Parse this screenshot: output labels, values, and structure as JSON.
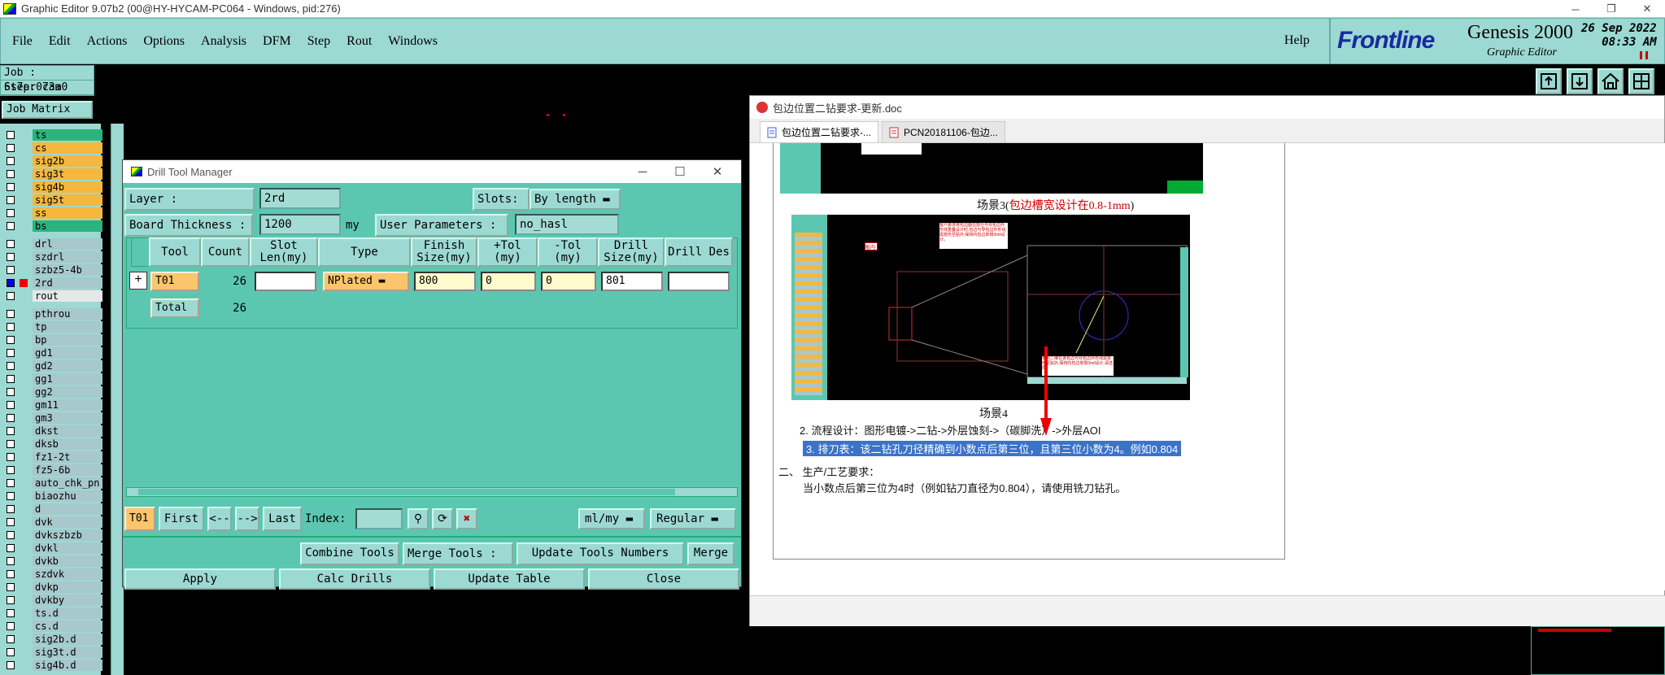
{
  "window": {
    "title": "Graphic Editor 9.07b2 (00@HY-HYCAM-PC064 - Windows, pid:276)",
    "min": "─",
    "restore": "❐",
    "close": "✕"
  },
  "menu": {
    "items": [
      "File",
      "Edit",
      "Actions",
      "Options",
      "Analysis",
      "DFM",
      "Step",
      "Rout",
      "Windows"
    ],
    "help": "Help"
  },
  "logo": {
    "brand": "Frontline",
    "product": "Genesis 2000",
    "subtitle": "Graphic Editor",
    "date": "26 Sep 2022",
    "time": "08:33 AM"
  },
  "job": {
    "job_line": "Job : 6s7er073a0",
    "step_line": "Step: cam",
    "matrix_btn": "Job Matrix ..."
  },
  "layers": {
    "group1": [
      {
        "name": "ts",
        "color": "#2bb37e"
      },
      {
        "name": "cs",
        "color": "#f5b73e"
      },
      {
        "name": "sig2b",
        "color": "#f5b73e"
      },
      {
        "name": "sig3t",
        "color": "#f5b73e"
      },
      {
        "name": "sig4b",
        "color": "#f5b73e"
      },
      {
        "name": "sig5t",
        "color": "#f5b73e"
      },
      {
        "name": "ss",
        "color": "#f5b73e"
      },
      {
        "name": "bs",
        "color": "#2bb37e"
      }
    ],
    "group2": [
      {
        "name": "drl",
        "color": "#a7c8cc"
      },
      {
        "name": "szdrl",
        "color": "#a7c8cc"
      },
      {
        "name": "szbz5-4b",
        "color": "#a7c8cc"
      },
      {
        "name": "2rd",
        "color": "#a7c8cc"
      },
      {
        "name": "rout",
        "color": "#e7e7e7"
      }
    ],
    "group3": [
      {
        "name": "pthrou",
        "color": "#a7c8cc"
      },
      {
        "name": "tp",
        "color": "#a7c8cc"
      },
      {
        "name": "bp",
        "color": "#a7c8cc"
      },
      {
        "name": "gd1",
        "color": "#a7c8cc"
      },
      {
        "name": "gd2",
        "color": "#a7c8cc"
      },
      {
        "name": "gg1",
        "color": "#a7c8cc"
      },
      {
        "name": "gg2",
        "color": "#a7c8cc"
      },
      {
        "name": "gm11",
        "color": "#a7c8cc"
      },
      {
        "name": "gm3",
        "color": "#a7c8cc"
      },
      {
        "name": "dkst",
        "color": "#a7c8cc"
      },
      {
        "name": "dksb",
        "color": "#a7c8cc"
      },
      {
        "name": "fz1-2t",
        "color": "#a7c8cc"
      },
      {
        "name": "fz5-6b",
        "color": "#a7c8cc"
      },
      {
        "name": "auto_chk_pn",
        "color": "#a7c8cc"
      },
      {
        "name": "biaozhu",
        "color": "#a7c8cc"
      },
      {
        "name": "d",
        "color": "#a7c8cc"
      },
      {
        "name": "dvk",
        "color": "#a7c8cc"
      },
      {
        "name": "dvkszbzb",
        "color": "#a7c8cc"
      },
      {
        "name": "dvkl",
        "color": "#a7c8cc"
      },
      {
        "name": "dvkb",
        "color": "#a7c8cc"
      },
      {
        "name": "szdvk",
        "color": "#a7c8cc"
      },
      {
        "name": "dvkp",
        "color": "#a7c8cc"
      },
      {
        "name": "dvkby",
        "color": "#a7c8cc"
      },
      {
        "name": "ts.d",
        "color": "#a7c8cc"
      },
      {
        "name": "cs.d",
        "color": "#a7c8cc"
      },
      {
        "name": "sig2b.d",
        "color": "#a7c8cc"
      },
      {
        "name": "sig3t.d",
        "color": "#a7c8cc"
      },
      {
        "name": "sig4b.d",
        "color": "#a7c8cc"
      }
    ]
  },
  "dtm": {
    "title": "Drill Tool Manager",
    "layer_label": "Layer            :",
    "layer_value": "2rd",
    "slots_label": "Slots:",
    "slots_value": "By length",
    "thickness_label": "Board Thickness :",
    "thickness_value": "1200",
    "thickness_unit": "my",
    "user_params_label": "User Parameters :",
    "user_params_value": "no_hasl",
    "headers": [
      "Tool",
      "Count",
      "Slot Len(my)",
      "Type",
      "Finish Size(my)",
      "+Tol (my)",
      "-Tol (my)",
      "Drill Size(my)",
      "Drill Des"
    ],
    "row": {
      "tool": "T01",
      "count": "26",
      "type": "NPlated",
      "finish": "800",
      "ptol": "0",
      "mtol": "0",
      "drill": "801"
    },
    "total_label": "Total",
    "total_count": "26",
    "nav": {
      "current": "T01",
      "first": "First",
      "prev": "<--",
      "next": "-->",
      "last": "Last",
      "index": "Index:",
      "units": "ml/my",
      "mode": "Regular"
    },
    "btns": {
      "combine": "Combine Tools",
      "merge_tools": "Merge Tools :",
      "update_numbers": "Update Tools Numbers",
      "merge": "Merge",
      "apply": "Apply",
      "calc": "Calc Drills",
      "update_table": "Update Table",
      "close": "Close"
    }
  },
  "doc": {
    "title": "包边位置二钻要求-更新.doc",
    "tabs": [
      "包边位置二钻要求-...",
      "PCN20181106-包边..."
    ],
    "caption3_a": "场景3(",
    "caption3_b": "包边槽宽设计在0.8-1mm",
    "caption3_c": ")",
    "caption4": "场景4",
    "line1": "2. 流程设计：图形电镀->二钻->外层蚀刻->（碳脚洗）->外层AOI",
    "line2": "3. 排刀表：该二钻孔刀径精确到小数点后第三位，且第三位小数为4。例如0.804",
    "section2": "二、  生产/工艺要求：",
    "line3": "当小数点后第三位为4时（例如钻刀直径为0.804），请使用铣刀钻孔。",
    "note_a": "客户要求将包边面在部分与导包边外形线重叠设计时,包边与导包边外形线需变形至贴外,保持内包边单侧3mil设计。",
    "note_b": "板内二维在该包边与导包边外形线需变形至贴外,保持内包边单侧3mil设计,请选择。",
    "label_red": "板内"
  }
}
